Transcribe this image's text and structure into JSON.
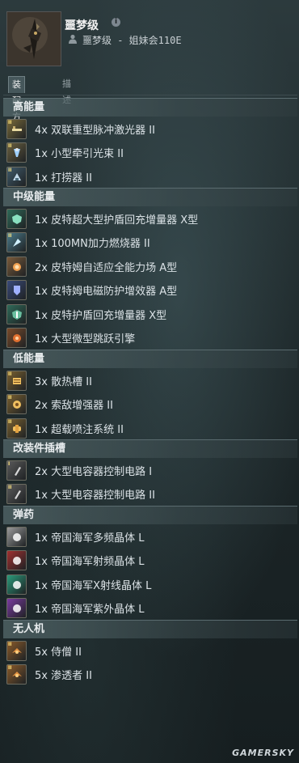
{
  "header": {
    "ship_name": "噩梦级",
    "pilot_line": "噩梦级 - 姐妹会110E",
    "info_glyph": "i"
  },
  "tabs": [
    {
      "label": "装配方案",
      "active": true
    },
    {
      "label": "描述",
      "active": false
    }
  ],
  "sections": [
    {
      "title": "高能量",
      "items": [
        {
          "text": "4x 双联重型脉冲激光器 II",
          "icon": "laser-icon",
          "tier": "II",
          "color": "#7a6a3a"
        },
        {
          "text": "1x 小型牵引光束 II",
          "icon": "tractor-beam-icon",
          "tier": "II",
          "color": "#6a6040"
        },
        {
          "text": "1x 打捞器 II",
          "icon": "salvager-icon",
          "tier": "II",
          "color": "#3f5a6a"
        }
      ]
    },
    {
      "title": "中级能量",
      "items": [
        {
          "text": "1x 皮特超大型护盾回充增量器 X型",
          "icon": "shield-extender-icon",
          "tier": "",
          "color": "#2f6a58"
        },
        {
          "text": "1x 100MN加力燃烧器 II",
          "icon": "afterburner-icon",
          "tier": "II",
          "color": "#4a7a8a"
        },
        {
          "text": "2x 皮特姆自适应全能力场 A型",
          "icon": "adaptive-field-icon",
          "tier": "",
          "color": "#7a5a3a"
        },
        {
          "text": "1x 皮特姆电磁防护增效器 A型",
          "icon": "em-amplifier-icon",
          "tier": "",
          "color": "#3a4a7a"
        },
        {
          "text": "1x 皮特护盾回充增量器 X型",
          "icon": "shield-recharger-icon",
          "tier": "",
          "color": "#2f6a58"
        },
        {
          "text": "1x 大型微型跳跃引擎",
          "icon": "micro-jump-drive-icon",
          "tier": "",
          "color": "#7a4a2a"
        }
      ]
    },
    {
      "title": "低能量",
      "items": [
        {
          "text": "3x 散热槽 II",
          "icon": "heat-sink-icon",
          "tier": "II",
          "color": "#7a6030"
        },
        {
          "text": "2x 索敌增强器 II",
          "icon": "signal-amplifier-icon",
          "tier": "II",
          "color": "#7a6030"
        },
        {
          "text": "1x 超载喷注系统 II",
          "icon": "overdrive-icon",
          "tier": "II",
          "color": "#7a6030"
        }
      ]
    },
    {
      "title": "改装件插槽",
      "items": [
        {
          "text": "2x 大型电容器控制电路 I",
          "icon": "capacitor-rig-icon",
          "tier": "I",
          "color": "#5a5a5a"
        },
        {
          "text": "1x 大型电容器控制电路 II",
          "icon": "capacitor-rig-icon",
          "tier": "II",
          "color": "#5a5a5a"
        }
      ]
    },
    {
      "title": "弹药",
      "items": [
        {
          "text": "1x 帝国海军多频晶体 L",
          "icon": "crystal-icon",
          "tier": "",
          "color": "#9a9a9a"
        },
        {
          "text": "1x 帝国海军射频晶体 L",
          "icon": "crystal-icon",
          "tier": "",
          "color": "#a03030"
        },
        {
          "text": "1x 帝国海军X射线晶体 L",
          "icon": "crystal-icon",
          "tier": "",
          "color": "#2a9a7a"
        },
        {
          "text": "1x 帝国海军紫外晶体 L",
          "icon": "crystal-icon",
          "tier": "",
          "color": "#7a3aa0"
        }
      ]
    },
    {
      "title": "无人机",
      "items": [
        {
          "text": "5x 侍僧 II",
          "icon": "drone-icon",
          "tier": "II",
          "color": "#8a5a2a"
        },
        {
          "text": "5x 渗透者 II",
          "icon": "drone-icon",
          "tier": "II",
          "color": "#8a5a2a"
        }
      ]
    }
  ],
  "watermark": "GAMERSKY"
}
